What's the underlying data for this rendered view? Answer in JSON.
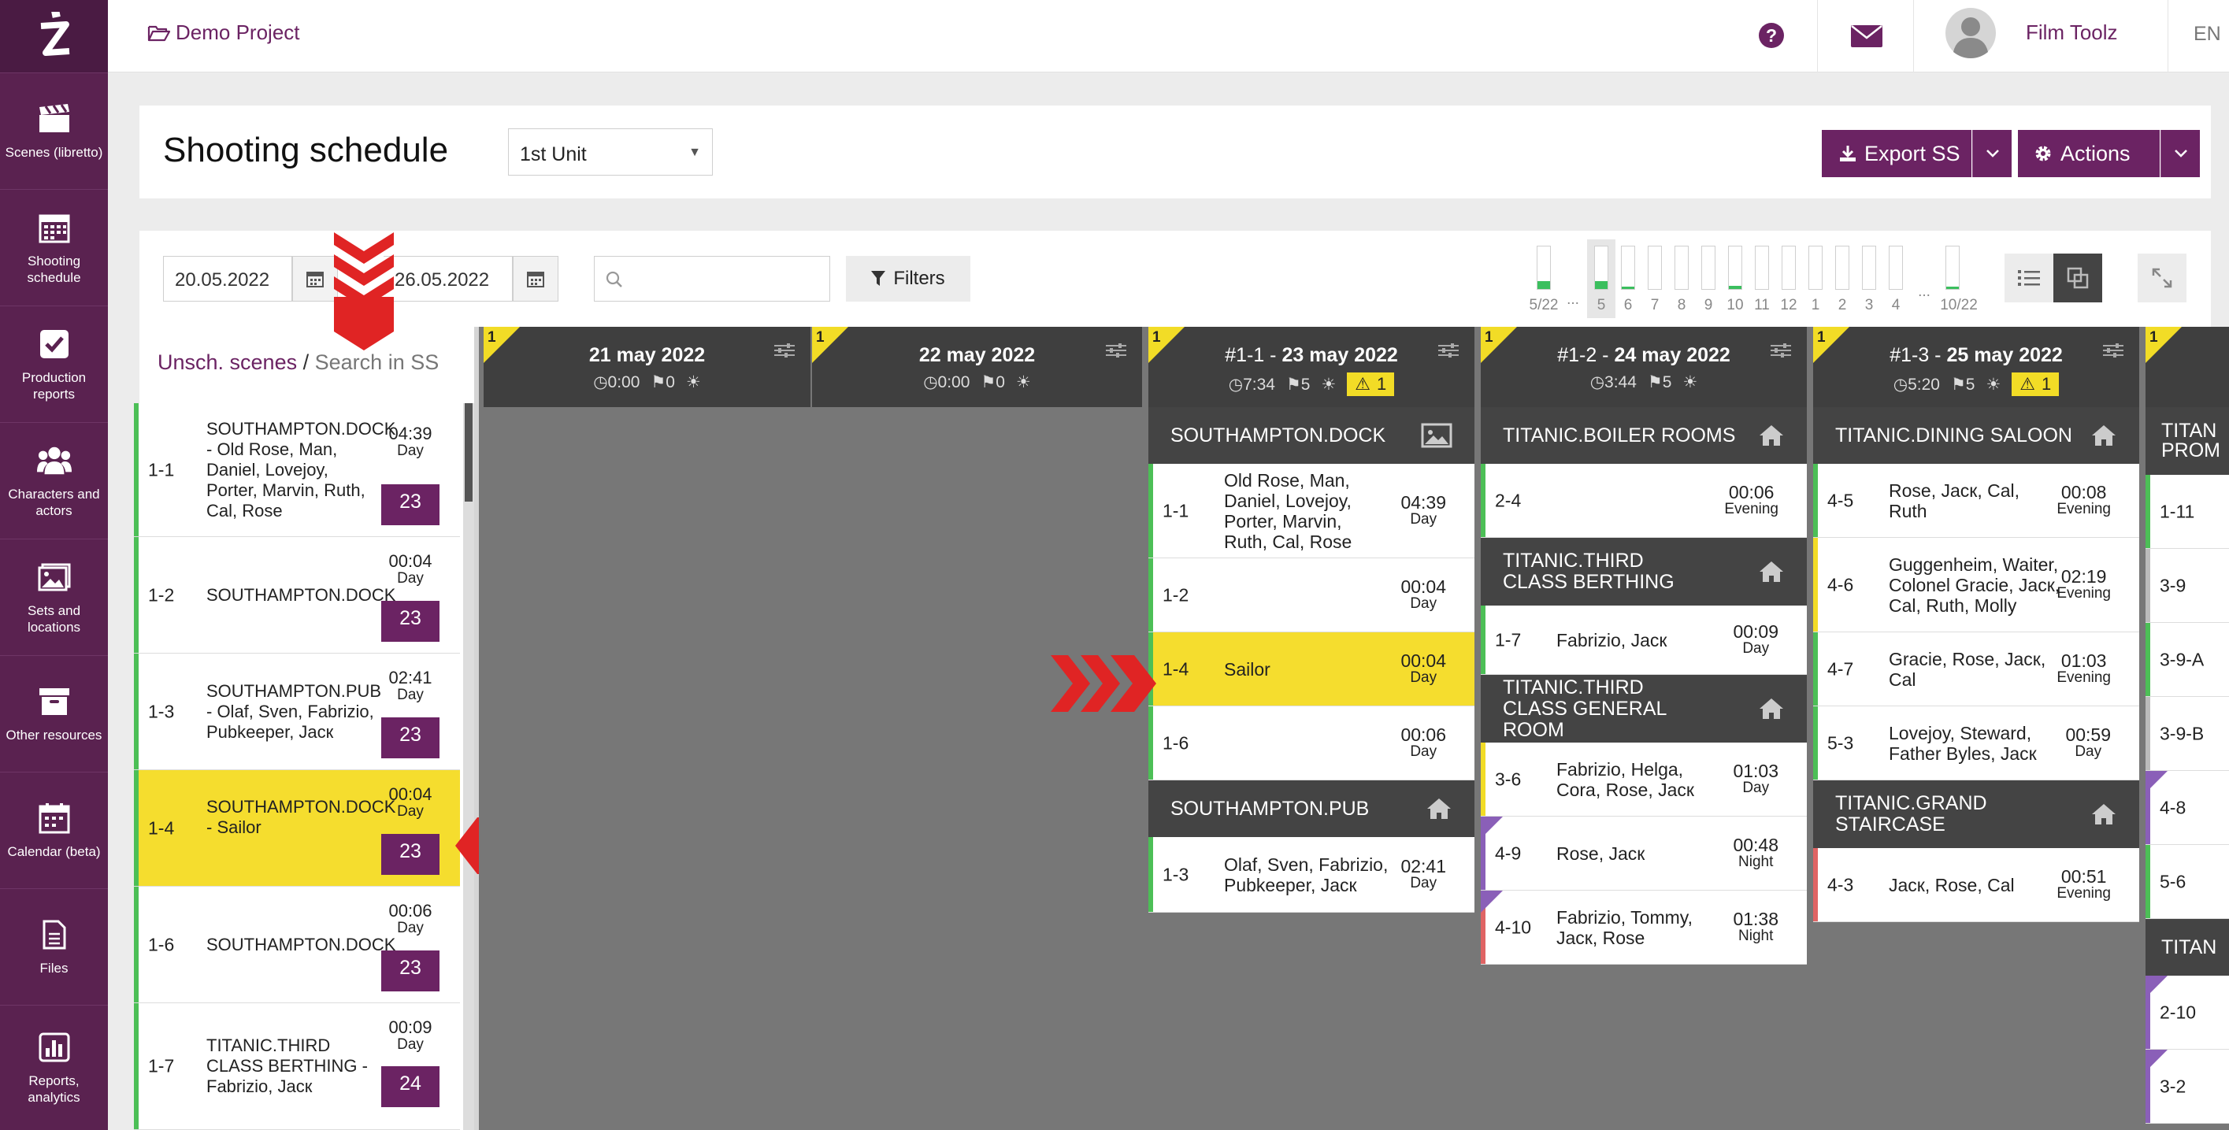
{
  "app": {
    "project": "Demo Project",
    "user_name": "Film Toolz",
    "language": "EN"
  },
  "sidebar": {
    "items": [
      {
        "label": "Scenes (libretto)",
        "icon": "clapperboard-icon"
      },
      {
        "label": "Shooting schedule",
        "icon": "calendar-grid-icon"
      },
      {
        "label": "Production reports",
        "icon": "checkbox-icon"
      },
      {
        "label": "Characters and actors",
        "icon": "people-icon"
      },
      {
        "label": "Sets and locations",
        "icon": "image-icon"
      },
      {
        "label": "Other resources",
        "icon": "archive-icon"
      },
      {
        "label": "Calendar (beta)",
        "icon": "calendar-icon"
      },
      {
        "label": "Files",
        "icon": "file-icon"
      },
      {
        "label": "Reports, analytics",
        "icon": "bar-chart-icon"
      }
    ]
  },
  "page": {
    "title": "Shooting schedule",
    "unit_selected": "1st Unit",
    "export_label": "Export SS",
    "actions_label": "Actions"
  },
  "toolbar": {
    "date_from": "20.05.2022",
    "date_to": "26.05.2022",
    "search_placeholder": "",
    "filters_label": "Filters"
  },
  "day_strip": {
    "labels": [
      "5/22",
      "...",
      "5",
      "6",
      "7",
      "8",
      "9",
      "10",
      "11",
      "12",
      "1",
      "2",
      "3",
      "4",
      "...",
      "10/22"
    ]
  },
  "left_panel": {
    "tab_unscheduled": "Unsch. scenes",
    "separator": "/",
    "tab_search": "Search in SS",
    "items": [
      {
        "num": "1-1",
        "text": "SOUTHAMPTON.DOCK - Old Rose, Man, Daniel, Lovejoy, Porter, Marvin, Ruth, Cal, Rose",
        "time": "04:39",
        "tod": "Day",
        "date": "23 may"
      },
      {
        "num": "1-2",
        "text": "SOUTHAMPTON.DOCK",
        "time": "00:04",
        "tod": "Day",
        "date": "23 may"
      },
      {
        "num": "1-3",
        "text": "SOUTHAMPTON.PUB - Olaf, Sven, Fabrizio, Pubkeeper, Jacк",
        "time": "02:41",
        "tod": "Day",
        "date": "23 may"
      },
      {
        "num": "1-4",
        "text": "SOUTHAMPTON.DOCK - Sailor",
        "time": "00:04",
        "tod": "Day",
        "date": "23 may"
      },
      {
        "num": "1-6",
        "text": "SOUTHAMPTON.DOCK",
        "time": "00:06",
        "tod": "Day",
        "date": "23 may"
      },
      {
        "num": "1-7",
        "text": "TITANIC.THIRD CLASS BERTHING - Fabrizio, Jacк",
        "time": "00:09",
        "tod": "Day",
        "date": "24 may"
      }
    ]
  },
  "days": [
    {
      "prefix": "",
      "date": "21 may 2022",
      "time": "0:00",
      "count": "0",
      "flag": "1",
      "warn": ""
    },
    {
      "prefix": "",
      "date": "22 may 2022",
      "time": "0:00",
      "count": "0",
      "flag": "1",
      "warn": ""
    },
    {
      "prefix": "#1-1 - ",
      "date": "23 may 2022",
      "time": "7:34",
      "count": "5",
      "flag": "1",
      "warn": "1",
      "sets": [
        {
          "name": "SOUTHAMPTON.DOCK",
          "icon": "image-icon",
          "scenes": [
            {
              "num": "1-1",
              "text": "Old Rose, Man, Daniel, Lovejoy, Porter, Marvin, Ruth, Cal, Rose",
              "time": "04:39",
              "tod": "Day"
            },
            {
              "num": "1-2",
              "text": "",
              "time": "00:04",
              "tod": "Day"
            },
            {
              "num": "1-4",
              "text": "Sailor",
              "time": "00:04",
              "tod": "Day"
            },
            {
              "num": "1-6",
              "text": "",
              "time": "00:06",
              "tod": "Day"
            }
          ]
        },
        {
          "name": "SOUTHAMPTON.PUB",
          "icon": "home-icon",
          "scenes": [
            {
              "num": "1-3",
              "text": "Olaf, Sven, Fabrizio, Pubkeeper, Jacк",
              "time": "02:41",
              "tod": "Day"
            }
          ]
        }
      ]
    },
    {
      "prefix": "#1-2 - ",
      "date": "24 may 2022",
      "time": "3:44",
      "count": "5",
      "flag": "1",
      "warn": "",
      "sets": [
        {
          "name": "TITANIC.BOILER ROOMS",
          "scenes": [
            {
              "num": "2-4",
              "text": "",
              "time": "00:06",
              "tod": "Evening"
            }
          ]
        },
        {
          "name": "TITANIC.THIRD CLASS BERTHING",
          "scenes": [
            {
              "num": "1-7",
              "text": "Fabrizio, Jacк",
              "time": "00:09",
              "tod": "Day"
            }
          ]
        },
        {
          "name": "TITANIC.THIRD CLASS GENERAL ROOM",
          "scenes": [
            {
              "num": "3-6",
              "text": "Fabrizio, Helga, Cora, Rose, Jacк",
              "time": "01:03",
              "tod": "Day"
            },
            {
              "num": "4-9",
              "text": "Rose, Jacк",
              "time": "00:48",
              "tod": "Night"
            },
            {
              "num": "4-10",
              "text": "Fabrizio, Tommy, Jacк, Rose",
              "time": "01:38",
              "tod": "Night"
            }
          ]
        }
      ]
    },
    {
      "prefix": "#1-3 - ",
      "date": "25 may 2022",
      "time": "5:20",
      "count": "5",
      "flag": "1",
      "warn": "1",
      "sets": [
        {
          "name": "TITANIC.DINING SALOON",
          "scenes": [
            {
              "num": "4-5",
              "text": "Rose, Jacк, Cal, Ruth",
              "time": "00:08",
              "tod": "Evening"
            },
            {
              "num": "4-6",
              "text": "Guggenheim, Waiter, Colonel Gracie, Jacк, Cal, Ruth, Molly",
              "time": "02:19",
              "tod": "Evening"
            },
            {
              "num": "4-7",
              "text": "Gracie, Rose, Jacк, Cal",
              "time": "01:03",
              "tod": "Evening"
            },
            {
              "num": "5-3",
              "text": "Lovejoy, Steward, Father Byles, Jacк",
              "time": "00:59",
              "tod": "Day"
            }
          ]
        },
        {
          "name": "TITANIC.GRAND STAIRCASE",
          "scenes": [
            {
              "num": "4-3",
              "text": "Jacк, Rose, Cal",
              "time": "00:51",
              "tod": "Evening"
            }
          ]
        }
      ]
    },
    {
      "flag": "1",
      "partial_set_1": "TITAN PROM",
      "partial_set_2": "TITAN",
      "partial_nums": [
        "1-11",
        "3-9",
        "3-9-A",
        "3-9-B",
        "4-8",
        "5-6",
        "2-10",
        "3-2"
      ]
    }
  ],
  "colors": {
    "brand": "#6b2363",
    "sidebar": "#5a2250",
    "highlight": "#f5dd2e",
    "set_header": "#444444",
    "day_header": "#3f3f3f",
    "arrow": "#e02424"
  }
}
